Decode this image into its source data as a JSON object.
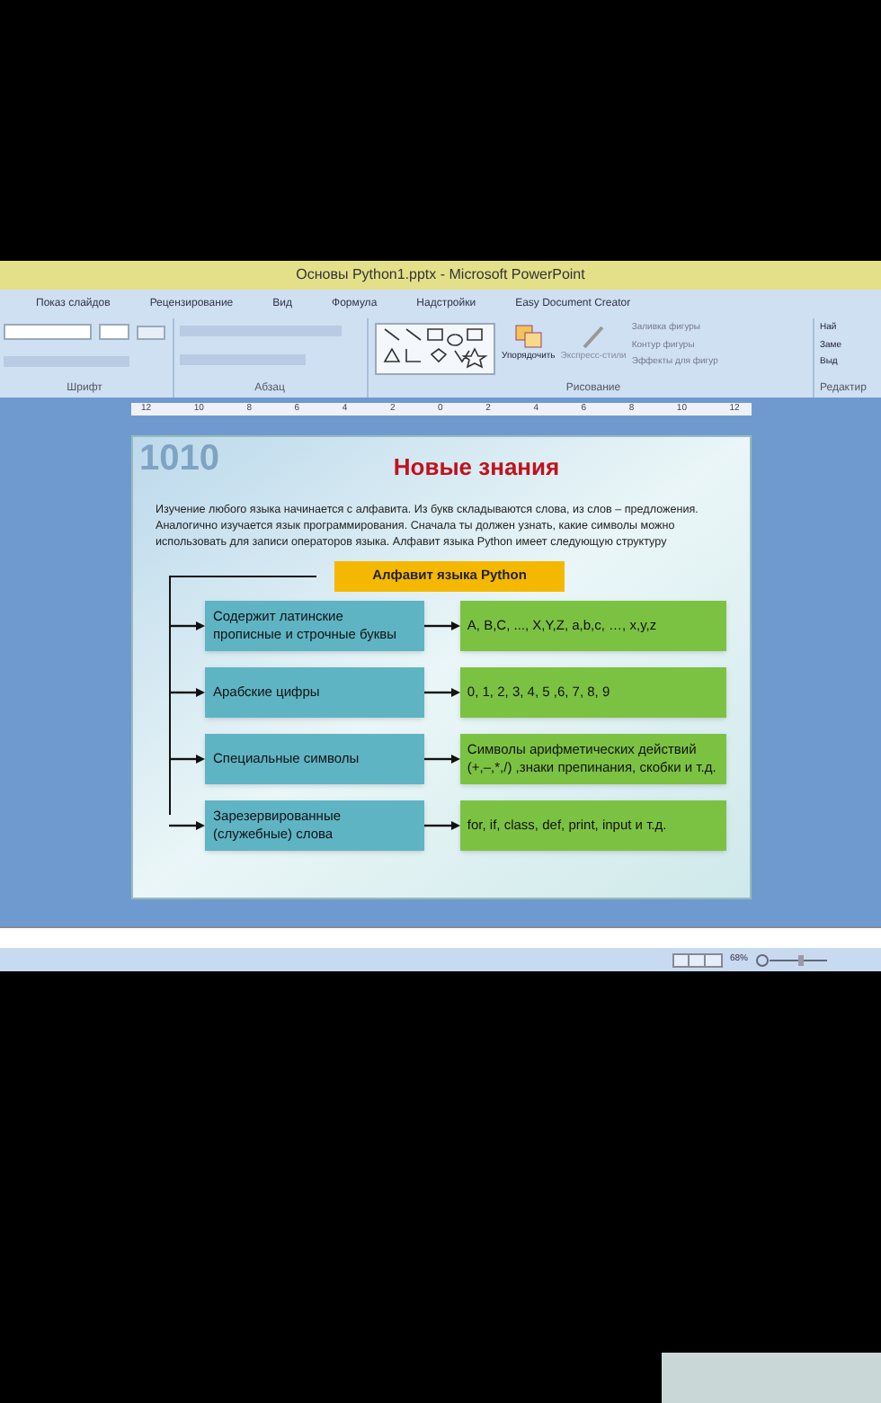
{
  "window": {
    "title": "Основы Python1.pptx - Microsoft PowerPoint"
  },
  "tabs": [
    {
      "label": "Показ слайдов",
      "selected": false
    },
    {
      "label": "Рецензирование",
      "selected": false
    },
    {
      "label": "Вид",
      "selected": false
    },
    {
      "label": "Формула",
      "selected": false
    },
    {
      "label": "Надстройки",
      "selected": false
    },
    {
      "label": "Easy Document Creator",
      "selected": false
    }
  ],
  "ribbon": {
    "groups": [
      {
        "label": "Шрифт"
      },
      {
        "label": "Абзац"
      },
      {
        "label": "Рисование"
      },
      {
        "label": "Редактир"
      }
    ],
    "arrange": "Упорядочить",
    "quick_styles": "Экспресс-стили",
    "shape_menu": [
      "Заливка фигуры",
      "Контур фигуры",
      "Эффекты для фигур"
    ],
    "editing": [
      "Най",
      "Заме",
      "Выд"
    ]
  },
  "ruler_labels": [
    "12",
    "10",
    "8",
    "6",
    "4",
    "2",
    "0",
    "2",
    "4",
    "6",
    "8",
    "10",
    "12"
  ],
  "slide": {
    "decor_text": "1010",
    "title": "Новые знания",
    "intro": "Изучение любого языка начинается с алфавита. Из букв складываются слова, из слов – предложения. Аналогично изучается язык программирования. Сначала ты должен узнать, какие символы можно использовать для записи операторов языка. Алфавит языка Python имеет следующую структуру",
    "header": "Алфавит языка Python",
    "rows": [
      {
        "left": "Содержит латинские прописные и строчные буквы",
        "right": "A, B,C, ..., X,Y,Z, a,b,c, …, x,y,z"
      },
      {
        "left": "Арабские цифры",
        "right": "0, 1, 2, 3, 4, 5 ,6, 7, 8, 9"
      },
      {
        "left": "Специальные символы",
        "right": "Символы арифметических действий (+,–,*,/) ,знаки препинания, скобки и т.д."
      },
      {
        "left": "Зарезервированные (служебные) слова",
        "right": "for, if, class, def, print, input и т.д."
      }
    ]
  },
  "status_bar": {
    "zoom": "68%"
  }
}
